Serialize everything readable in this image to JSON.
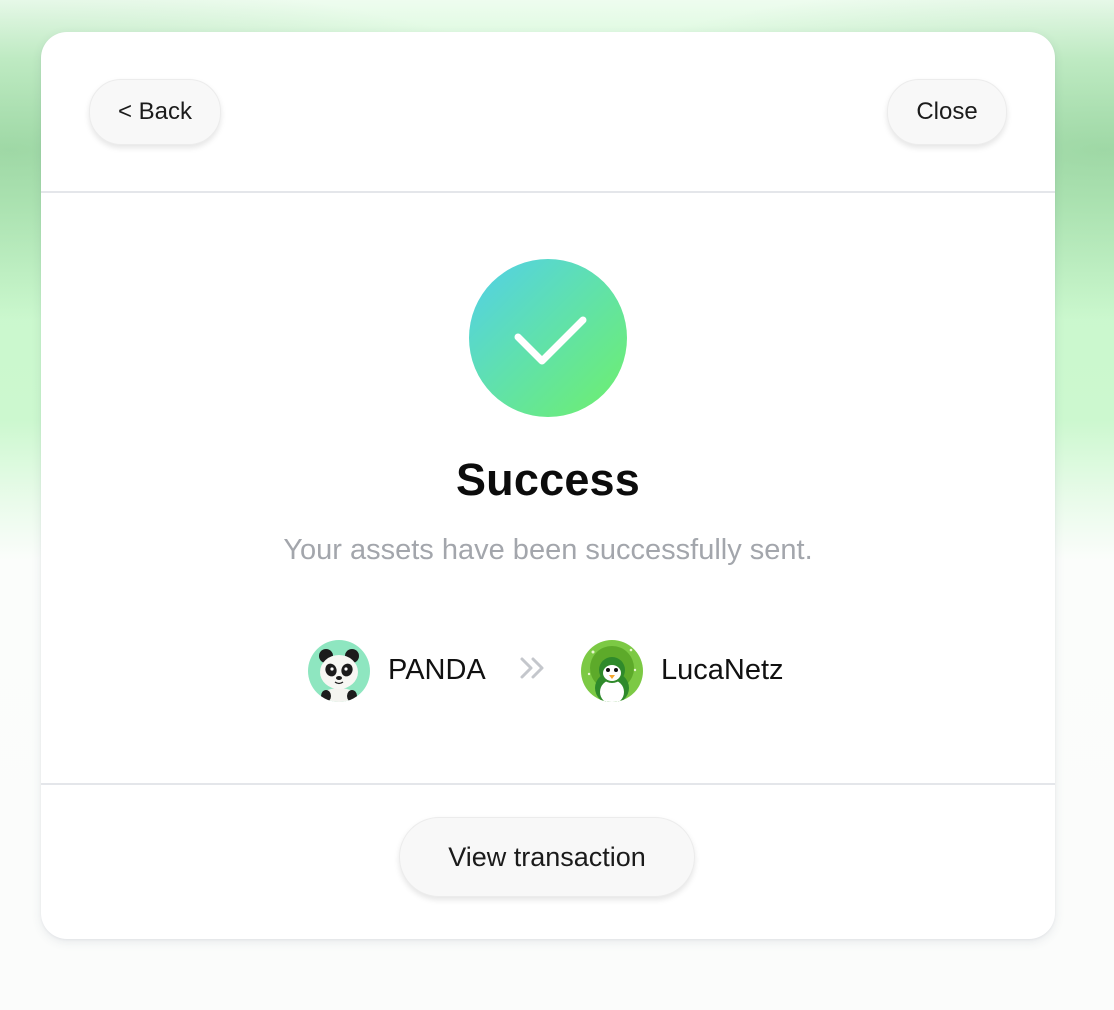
{
  "header": {
    "back_label": "< Back",
    "close_label": "Close"
  },
  "status": {
    "title": "Success",
    "message": "Your assets have been successfully sent."
  },
  "transfer": {
    "from": {
      "name": "PANDA",
      "avatar_icon": "panda-avatar-icon"
    },
    "arrow_icon": "double-chevron-right-icon",
    "to": {
      "name": "LucaNetz",
      "avatar_icon": "penguin-avatar-icon"
    }
  },
  "footer": {
    "view_transaction_label": "View transaction"
  },
  "colors": {
    "gradient_start": "#52cfea",
    "gradient_end": "#6ff06a",
    "subtitle_text": "#a3a6ac",
    "background_green": "#c9f7cc"
  }
}
